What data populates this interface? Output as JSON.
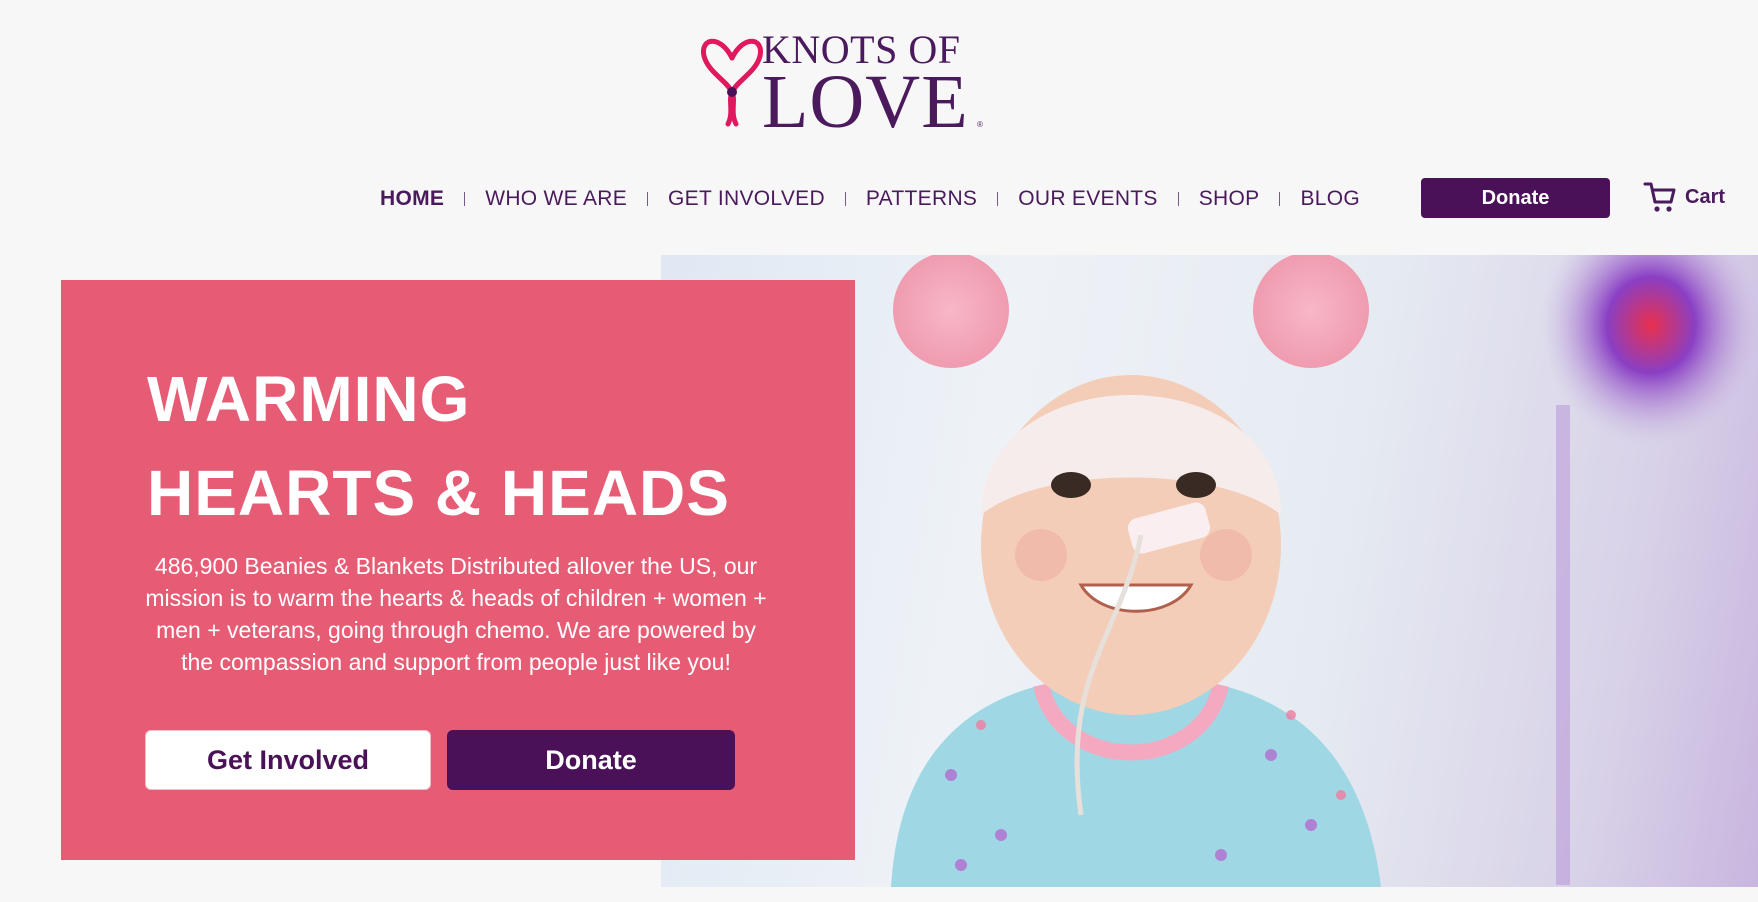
{
  "brand": {
    "logo_line1": "KNOTS OF",
    "logo_line2": "LOVE",
    "registered_mark": "®",
    "primary_color": "#4a1158",
    "accent_color": "#e65c75",
    "heart_color": "#e0195e"
  },
  "nav": {
    "items": [
      {
        "label": "HOME",
        "active": true
      },
      {
        "label": "WHO WE ARE",
        "active": false
      },
      {
        "label": "GET INVOLVED",
        "active": false
      },
      {
        "label": "PATTERNS",
        "active": false
      },
      {
        "label": "OUR EVENTS",
        "active": false
      },
      {
        "label": "SHOP",
        "active": false
      },
      {
        "label": "BLOG",
        "active": false
      }
    ],
    "donate_label": "Donate",
    "cart_label": "Cart",
    "cart_icon": "shopping-cart-icon"
  },
  "hero": {
    "title_line1": "WARMING",
    "title_line2": "HEARTS & HEADS",
    "description": "486,900 Beanies & Blankets Distributed allover the US, our mission is to warm the hearts & heads of children + women + men + veterans, going through chemo. We are powered by the compassion and support from people just like you!",
    "get_involved_label": "Get Involved",
    "donate_label": "Donate"
  }
}
